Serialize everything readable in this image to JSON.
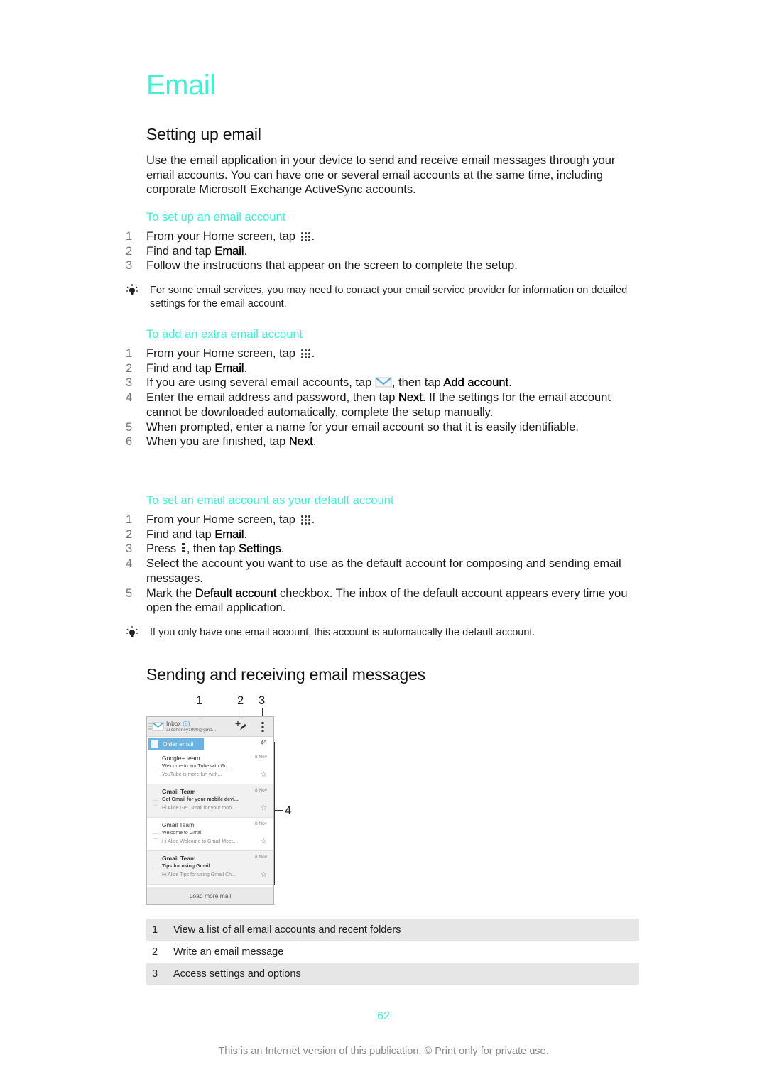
{
  "page": {
    "title": "Email",
    "page_number": "62",
    "footer": "This is an Internet version of this publication. © Print only for private use.",
    "accent_color": "#3ff0d6"
  },
  "setup": {
    "heading": "Setting up email",
    "intro": "Use the email application in your device to send and receive email messages through your email accounts. You can have one or several email accounts at the same time, including corporate Microsoft Exchange ActiveSync accounts.",
    "set_up": {
      "heading": "To set up an email account",
      "steps": [
        {
          "num": "1",
          "pre": "From your Home screen, tap ",
          "icon": "apps-icon",
          "post": "."
        },
        {
          "num": "2",
          "pre": "Find and tap ",
          "bold": "Email",
          "post": "."
        },
        {
          "num": "3",
          "pre": "Follow the instructions that appear on the screen to complete the setup."
        }
      ],
      "tip": "For some email services, you may need to contact your email service provider for information on detailed settings for the email account."
    },
    "add_extra": {
      "heading": "To add an extra email account",
      "steps": [
        {
          "num": "1",
          "pre": "From your Home screen, tap ",
          "icon": "apps-icon",
          "post": "."
        },
        {
          "num": "2",
          "pre": "Find and tap ",
          "bold": "Email",
          "post": "."
        },
        {
          "num": "3",
          "pre": "If you are using several email accounts, tap ",
          "icon": "mail-icon",
          "mid": ", then tap ",
          "bold": "Add account",
          "post": "."
        },
        {
          "num": "4",
          "pre": "Enter the email address and password, then tap ",
          "bold": "Next",
          "post": ". If the settings for the email account cannot be downloaded automatically, complete the setup manually."
        },
        {
          "num": "5",
          "pre": "When prompted, enter a name for your email account so that it is easily identifiable."
        },
        {
          "num": "6",
          "pre": "When you are finished, tap ",
          "bold": "Next",
          "post": "."
        }
      ]
    },
    "set_default": {
      "heading": "To set an email account as your default account",
      "steps": [
        {
          "num": "1",
          "pre": "From your Home screen, tap ",
          "icon": "apps-icon",
          "post": "."
        },
        {
          "num": "2",
          "pre": "Find and tap ",
          "bold": "Email",
          "post": "."
        },
        {
          "num": "3",
          "pre": "Press ",
          "icon": "menu-icon",
          "mid": ", then tap ",
          "bold": "Settings",
          "post": "."
        },
        {
          "num": "4",
          "pre": "Select the account you want to use as the default account for composing and sending email messages."
        },
        {
          "num": "5",
          "pre": "Mark the ",
          "bold": "Default account",
          "post": " checkbox. The inbox of the default account appears every time you open the email application."
        }
      ],
      "tip": "If you only have one email account, this account is automatically the default account."
    }
  },
  "sending": {
    "heading": "Sending and receiving email messages",
    "callouts": [
      "1",
      "2",
      "3",
      "4"
    ],
    "screenshot": {
      "inbox_label": "Inbox",
      "inbox_count": "(8)",
      "account": "alicehoney1990@gma...",
      "older_email": "Older email",
      "older_count": "4^",
      "mails": [
        {
          "from": "Google+ team",
          "date": "8 Nov",
          "subject": "Welcome to YouTube with Go...",
          "preview": "YouTube is more fun with...",
          "unread": false
        },
        {
          "from": "Gmail Team",
          "date": "8 Nov",
          "subject": "Get Gmail for your mobile devi...",
          "preview": "Hi Alice Get Gmail for your mobi...",
          "unread": true
        },
        {
          "from": "Gmail Team",
          "date": "8 Nov",
          "subject": "Welcome to Gmail",
          "preview": "Hi Alice Welcome to Gmail Meet...",
          "unread": false
        },
        {
          "from": "Gmail Team",
          "date": "8 Nov",
          "subject": "Tips for using Gmail",
          "preview": "Hi Alice Tips for using Gmail Ch...",
          "unread": true
        }
      ],
      "load_more": "Load more mail"
    },
    "legend": [
      {
        "num": "1",
        "text": "View a list of all email accounts and recent folders"
      },
      {
        "num": "2",
        "text": "Write an email message"
      },
      {
        "num": "3",
        "text": "Access settings and options"
      }
    ]
  }
}
